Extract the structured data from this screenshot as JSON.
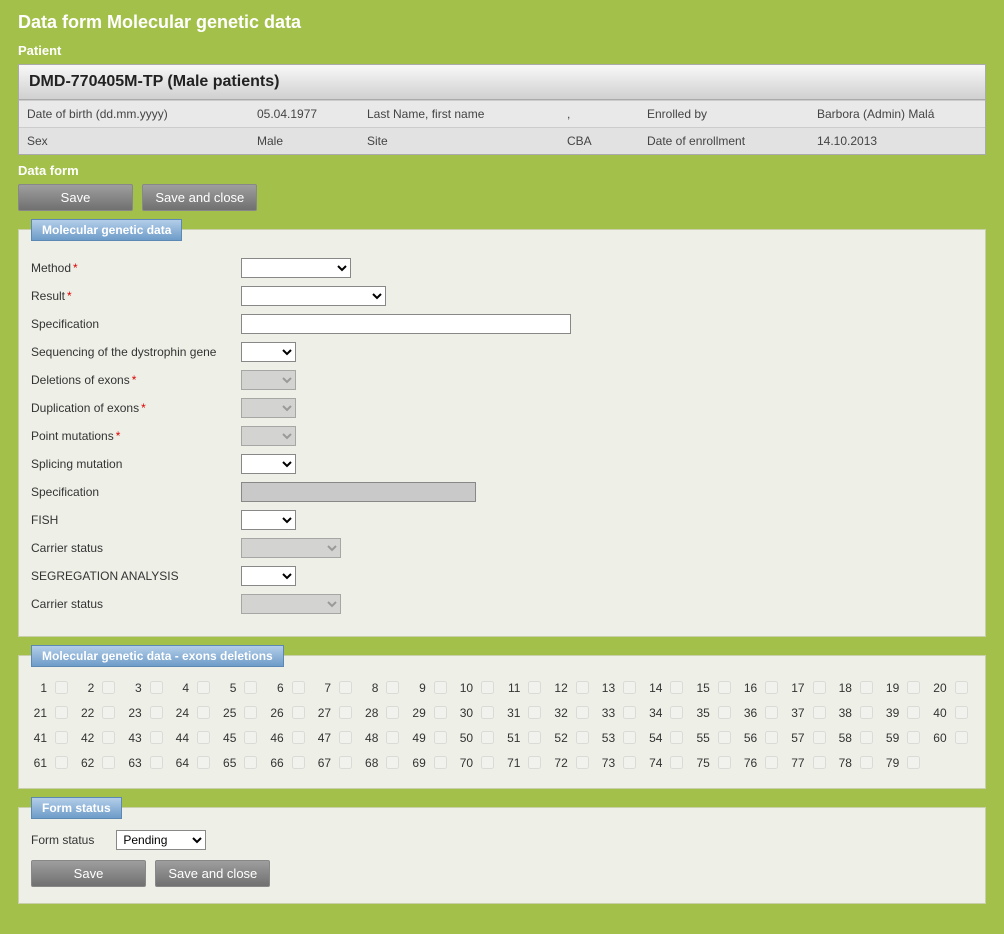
{
  "page": {
    "title": "Data form Molecular genetic data",
    "patient_label": "Patient",
    "dataform_label": "Data form"
  },
  "patient": {
    "header": "DMD-770405M-TP (Male patients)",
    "dob_label": "Date of birth (dd.mm.yyyy)",
    "dob_value": "05.04.1977",
    "name_label": "Last Name, first name",
    "name_value": ",",
    "enrolled_by_label": "Enrolled by",
    "enrolled_by_value": "Barbora (Admin) Malá",
    "sex_label": "Sex",
    "sex_value": "Male",
    "site_label": "Site",
    "site_value": "CBA",
    "enroll_date_label": "Date of enrollment",
    "enroll_date_value": "14.10.2013"
  },
  "buttons": {
    "save": "Save",
    "save_close": "Save and close"
  },
  "panel1": {
    "title": "Molecular genetic data",
    "fields": {
      "method": "Method",
      "result": "Result",
      "specification": "Specification",
      "seq": "Sequencing of the dystrophin gene",
      "del": "Deletions of exons",
      "dup": "Duplication of exons",
      "point": "Point mutations",
      "splicing": "Splicing mutation",
      "specification2": "Specification",
      "fish": "FISH",
      "carrier1": "Carrier status",
      "segreg": "SEGREGATION ANALYSIS",
      "carrier2": "Carrier status"
    }
  },
  "panel2": {
    "title": "Molecular genetic data - exons deletions",
    "exon_count": 79
  },
  "panel3": {
    "title": "Form status",
    "status_label": "Form status",
    "status_value": "Pending"
  }
}
